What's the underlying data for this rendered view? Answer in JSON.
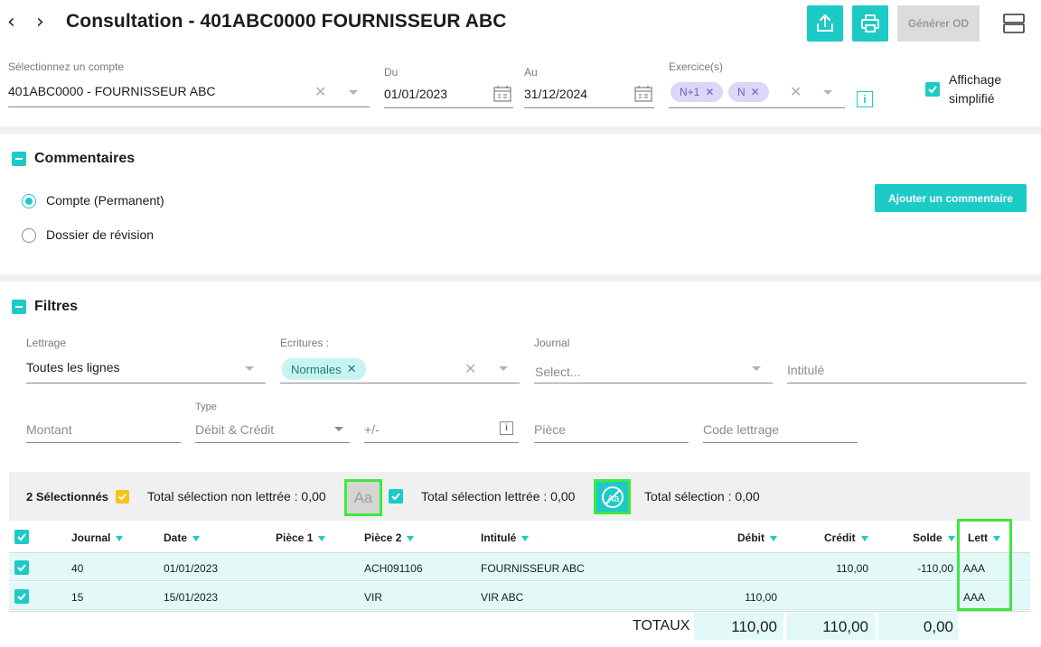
{
  "header": {
    "title": "Consultation - 401ABC0000 FOURNISSEUR ABC",
    "generate_label": "Générer OD"
  },
  "filters_top": {
    "account_label": "Sélectionnez un compte",
    "account_value": "401ABC0000 - FOURNISSEUR ABC",
    "from_label": "Du",
    "from_value": "01/01/2023",
    "to_label": "Au",
    "to_value": "31/12/2024",
    "exercise_label": "Exercice(s)",
    "exercise_chips": [
      "N+1",
      "N"
    ],
    "simplified_label_1": "Affichage",
    "simplified_label_2": "simplifié"
  },
  "comments": {
    "title": "Commentaires",
    "radio_1": "Compte (Permanent)",
    "radio_2": "Dossier de révision",
    "add_label": "Ajouter un commentaire"
  },
  "filters": {
    "title": "Filtres",
    "lettrage_label": "Lettrage",
    "lettrage_value": "Toutes les lignes",
    "ecritures_label": "Ecritures :",
    "ecritures_chip": "Normales",
    "journal_label": "Journal",
    "journal_placeholder": "Select...",
    "intitule_placeholder": "Intitulé",
    "montant_placeholder": "Montant",
    "type_label": "Type",
    "type_value": "Débit & Crédit",
    "plusminus_placeholder": "+/-",
    "piece_placeholder": "Pièce",
    "code_placeholder": "Code lettrage"
  },
  "selection": {
    "count_label": "2 Sélectionnés",
    "non_lettree": "Total sélection non lettrée : 0,00",
    "aa_label": "Aa",
    "lettree": "Total sélection lettrée : 0,00",
    "total": "Total sélection : 0,00"
  },
  "table": {
    "headers": [
      "Journal",
      "Date",
      "Pièce 1",
      "Pièce 2",
      "Intitulé",
      "Débit",
      "Crédit",
      "Solde",
      "Lett"
    ],
    "rows": [
      {
        "journal": "40",
        "date": "01/01/2023",
        "piece1": "",
        "piece2": "ACH091106",
        "intitule": "FOURNISSEUR ABC",
        "debit": "",
        "credit": "110,00",
        "solde": "-110,00",
        "lett": "AAA"
      },
      {
        "journal": "15",
        "date": "15/01/2023",
        "piece1": "",
        "piece2": "VIR",
        "intitule": "VIR ABC",
        "debit": "110,00",
        "credit": "",
        "solde": "",
        "lett": "AAA"
      }
    ],
    "totals_label": "TOTAUX",
    "total_debit": "110,00",
    "total_credit": "110,00",
    "total_solde": "0,00"
  },
  "colors": {
    "accent": "#1ccac6",
    "highlight": "#3ee83e",
    "row_bg": "#e2f9f8",
    "chip_purple": "#dcd6f7"
  }
}
